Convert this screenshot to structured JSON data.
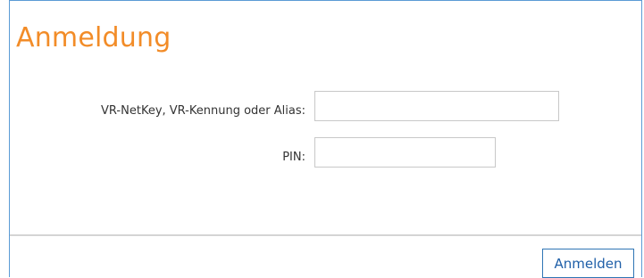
{
  "form": {
    "title": "Anmeldung",
    "user_label": "VR-NetKey, VR-Kennung oder Alias:",
    "user_value": "",
    "pin_label": "PIN:",
    "pin_value": "",
    "submit_label": "Anmelden"
  },
  "colors": {
    "title": "#f28c28",
    "frame_border": "#5b9bd5",
    "button_border": "#2f75b5",
    "button_text": "#1f5fa8"
  }
}
